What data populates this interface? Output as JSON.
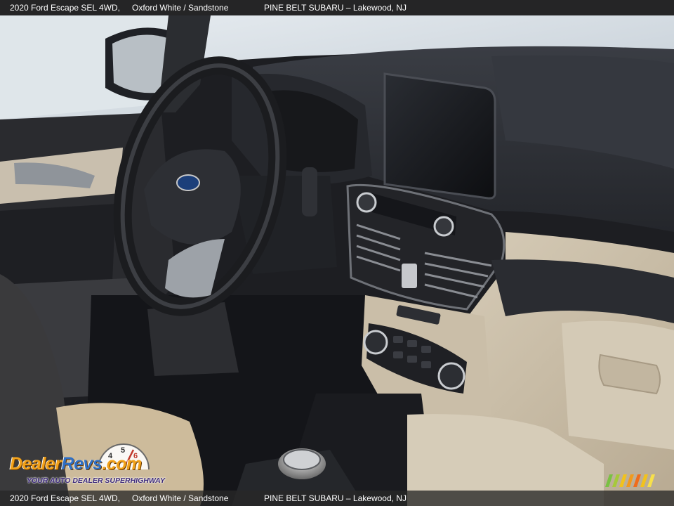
{
  "caption": {
    "model": "2020 Ford Escape SEL 4WD,",
    "color": "Oxford White / Sandstone",
    "dealer": "PINE BELT SUBARU – Lakewood, NJ"
  },
  "watermark": {
    "brand_a": "Dealer",
    "brand_b": "Revs",
    "brand_c": ".com",
    "tagline": "YOUR AUTO DEALER SUPERHIGHWAY",
    "gauge_numbers": [
      "4",
      "5",
      "6"
    ]
  },
  "colors": {
    "dashboard": "#2e3036",
    "trim_sandstone": "#cfc3ad",
    "caption_bar": "#282828",
    "logo_orange": "#f2a21b",
    "logo_blue": "#2f6fc4"
  },
  "icons": [
    "steering-wheel-icon",
    "infotainment-screen-icon",
    "gear-selector-icon"
  ]
}
